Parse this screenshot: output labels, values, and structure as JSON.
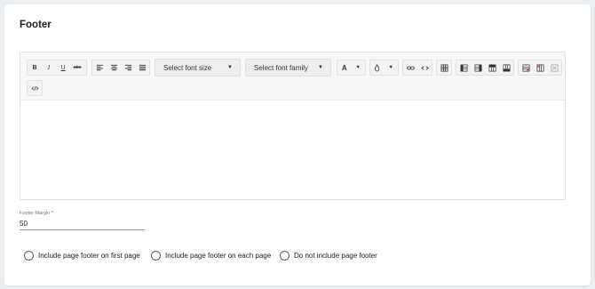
{
  "section": {
    "title": "Footer"
  },
  "toolbar": {
    "bold": "B",
    "italic": "I",
    "underline": "U",
    "strikethrough": "abc",
    "font_size_placeholder": "Select font size",
    "font_family_placeholder": "Select font family",
    "font_color": "A",
    "caret": "▼"
  },
  "margin": {
    "label": "Footer Margin *",
    "value": "50"
  },
  "options": [
    {
      "label": "Include page footer on first page"
    },
    {
      "label": "Include page footer on each page"
    },
    {
      "label": "Do not include page footer"
    }
  ],
  "colors": {
    "background": "#eceff1",
    "card": "#ffffff",
    "toolbar": "#f7f7f7",
    "border": "#e0e0e0"
  }
}
